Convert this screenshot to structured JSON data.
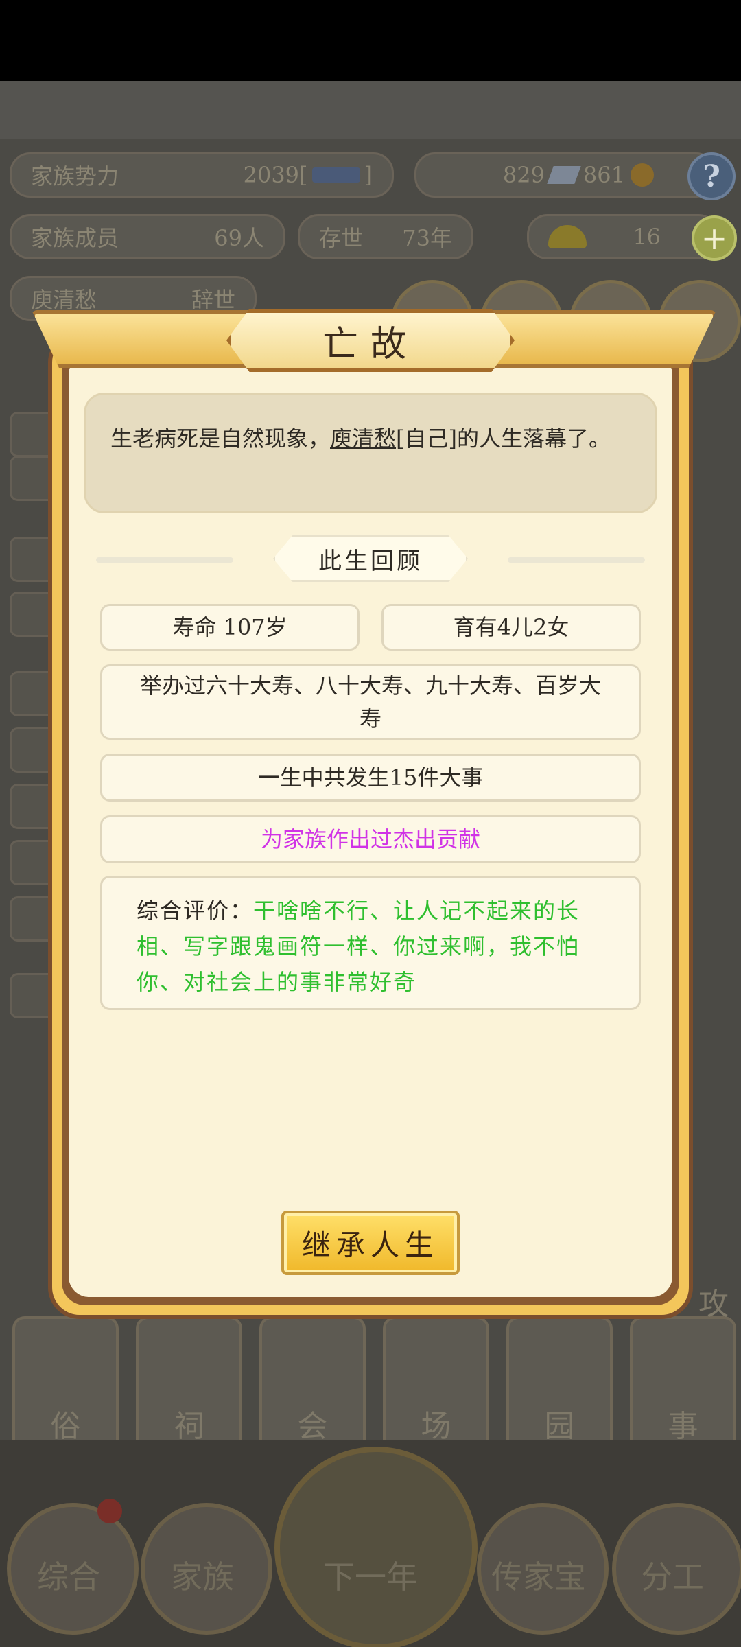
{
  "background": {
    "family_power_label": "家族势力",
    "family_power_value": "2039[",
    "family_power_suffix": "]",
    "resources_value": "829",
    "resources_value2": "861",
    "help_glyph": "?",
    "members_label": "家族成员",
    "members_value": "69人",
    "alive_label": "存世",
    "alive_value": "73年",
    "gold_value": "16",
    "plus_glyph": "+",
    "person_name": "庾清愁",
    "person_status": "辞世",
    "tabs": [
      "俗",
      "祠",
      "会",
      "场",
      "园",
      "事"
    ],
    "tab_top_right": "攻",
    "nav": [
      "综合",
      "家族",
      "下一年",
      "传家宝",
      "分工"
    ]
  },
  "dialog": {
    "title": "亡故",
    "intro_prefix": "生老病死是自然现象，",
    "intro_name": "庾清愁",
    "intro_suffix": "[自己]的人生落幕了。",
    "review_title": "此生回顾",
    "lifespan": "寿命 107岁",
    "children": "育有4儿2女",
    "birthdays": "举办过六十大寿、八十大寿、九十大寿、百岁大寿",
    "events": "一生中共发生15件大事",
    "contribution": "为家族作出过杰出贡献",
    "eval_label": "综合评价：",
    "eval_text": "干啥啥不行、让人记不起来的长相、写字跟鬼画符一样、你过来啊，我不怕你、对社会上的事非常好奇",
    "inherit_button": "继承人生"
  },
  "colors": {
    "contribution": "#d033e6",
    "evaluation": "#2fbf2f",
    "panel": "#fbf3d8",
    "frame": "#f3c65b"
  }
}
